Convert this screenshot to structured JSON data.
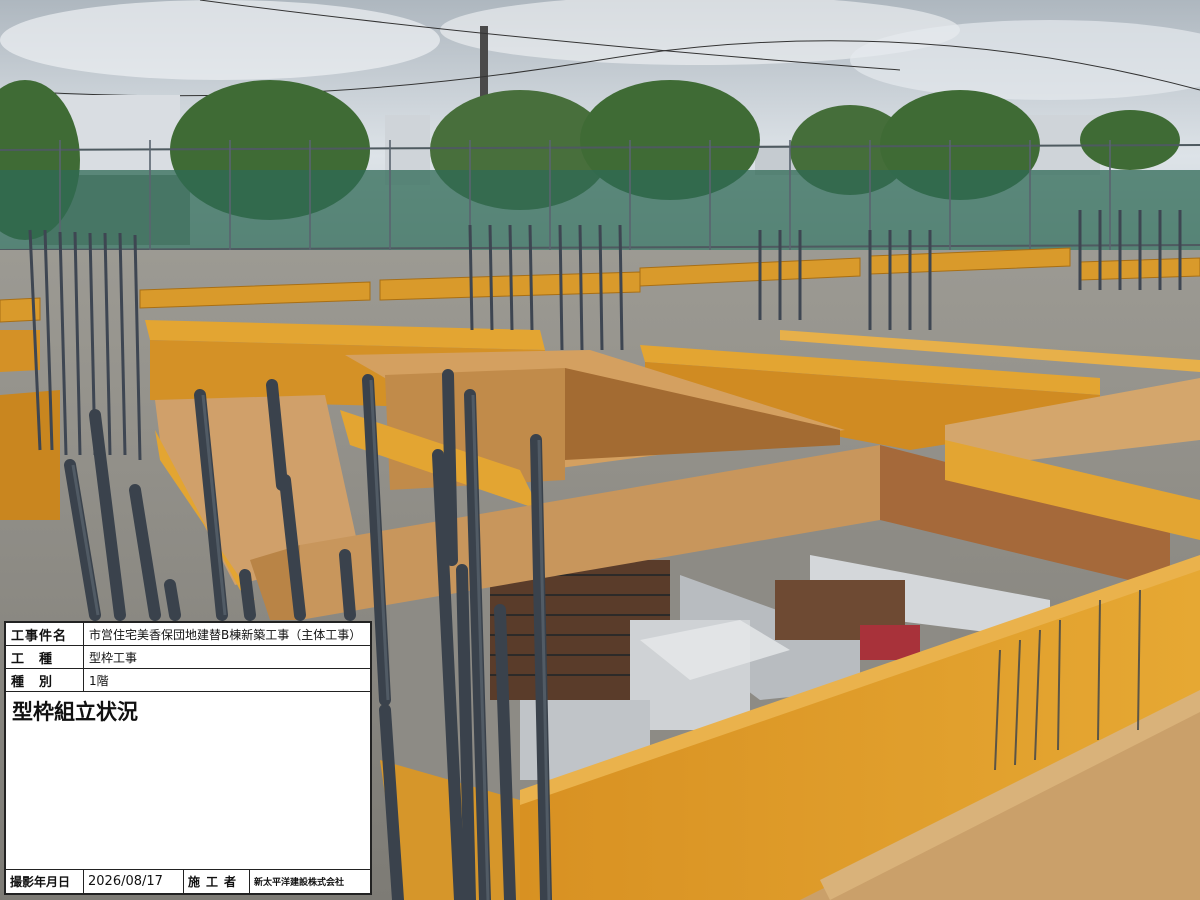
{
  "photo": {
    "description_icon": "construction-site-formwork-photo"
  },
  "board": {
    "project_label": "工事件名",
    "project_value": "市営住宅美香保団地建替B棟新築工事（主体工事）",
    "work_type_label": "工　種",
    "work_type_value": "型枠工事",
    "category_label": "種　別",
    "category_value": "1階",
    "subject": "型枠組立状況",
    "date_label": "撮影年月日",
    "date_value": "2026/08/17",
    "contractor_label": "施工者",
    "contractor_value": "新太平洋建設株式会社"
  },
  "colors": {
    "plywood": "#e0a025",
    "timber": "#c89a62",
    "rebar": "#3e4652",
    "sky": "#cfd6dd",
    "trees": "#3f6b35"
  }
}
